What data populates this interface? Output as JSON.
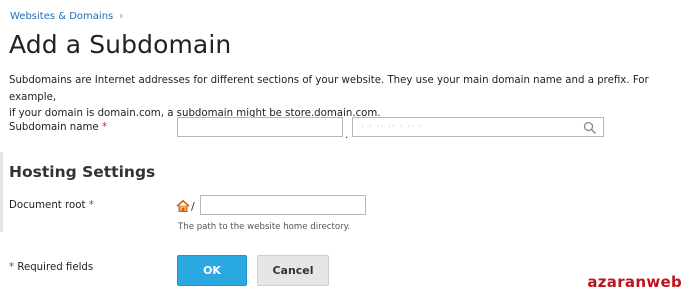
{
  "breadcrumb": {
    "label": "Websites & Domains",
    "chevron": "chevron-right-icon"
  },
  "page_title": "Add a Subdomain",
  "intro": {
    "line1": "Subdomains are Internet addresses for different sections of your website. They use your main domain name and a prefix. For example,",
    "line2": "if your domain is domain.com, a subdomain might be store.domain.com."
  },
  "form": {
    "subdomain_label": "Subdomain name",
    "subdomain_value": "",
    "separator": ".",
    "domain_value": "· · ·· ·· · ·· ·",
    "section_title": "Hosting Settings",
    "docroot_label": "Document root",
    "docroot_prefix": "/",
    "docroot_value": "",
    "docroot_hint": "The path to the website home directory.",
    "required_star": "*",
    "required_note": "* Required fields"
  },
  "buttons": {
    "ok": "OK",
    "cancel": "Cancel"
  },
  "watermark": "azaranweb",
  "colors": {
    "accent": "#29a9e0",
    "link": "#1f6fb5",
    "required": "#d2232a",
    "watermark": "#c0121b"
  }
}
